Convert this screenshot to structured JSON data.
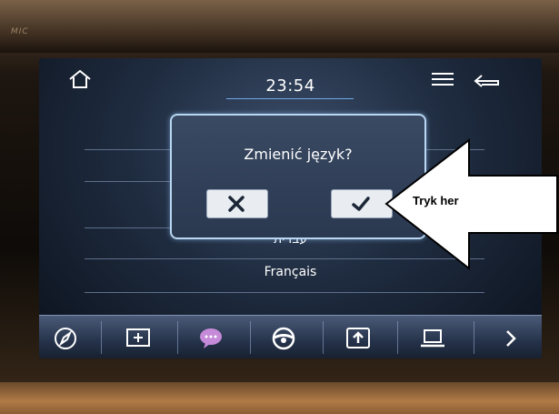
{
  "device": {
    "brand_mark": "MIC"
  },
  "status_bar": {
    "time": "23:54"
  },
  "language_list": {
    "items": [
      "עברית",
      "Français"
    ]
  },
  "dialog": {
    "title": "Zmienić język?",
    "cancel_icon": "x-icon",
    "confirm_icon": "check-icon"
  },
  "dock": {
    "items": [
      "compass-icon",
      "screen-icon",
      "chat-bubble-icon",
      "steering-wheel-icon",
      "upload-icon",
      "laptop-icon",
      "chevron-right-icon"
    ]
  },
  "annotation": {
    "text": "Tryk her"
  },
  "colors": {
    "accent": "#6fa9e8",
    "dialog_border": "#b9d6f2",
    "chat_icon": "#c58ad8"
  }
}
